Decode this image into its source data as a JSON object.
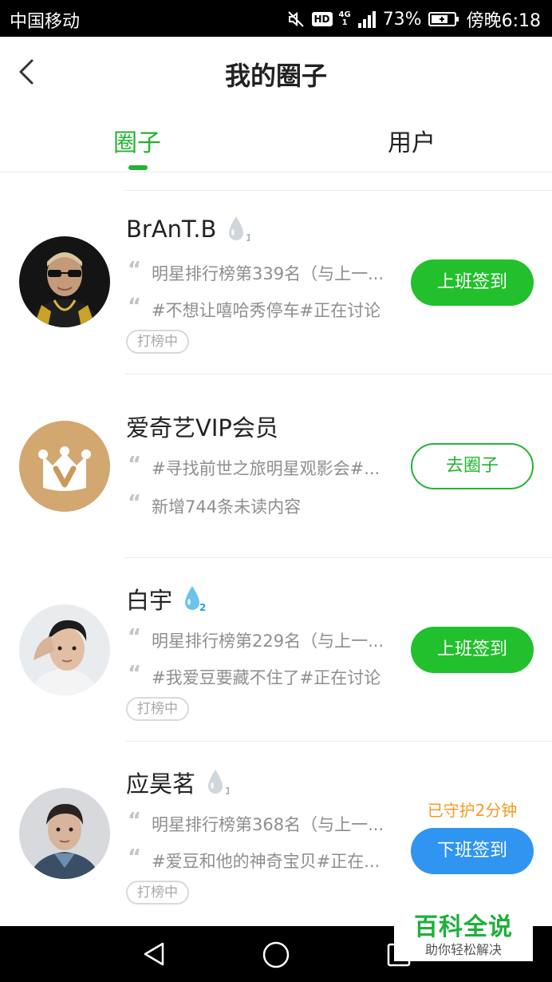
{
  "status_bar": {
    "carrier": "中国移动",
    "hd": "HD",
    "network_top": "4G",
    "network_bottom": "1",
    "battery_percent": "73%",
    "time": "傍晚6:18"
  },
  "header": {
    "title": "我的圈子"
  },
  "tabs": [
    {
      "label": "圈子",
      "active": true
    },
    {
      "label": "用户",
      "active": false
    }
  ],
  "colors": {
    "accent_green": "#22c02c",
    "blue": "#2f95f0",
    "orange": "#f59a23"
  },
  "items": [
    {
      "name": "BrAnT.B",
      "badge_icon": "water-drop-icon",
      "badge_level": "1",
      "lines": [
        "明星排行榜第339名（与上一...",
        "#不想让嘻哈秀停车#正在讨论"
      ],
      "tag": "打榜中",
      "button": "上班签到"
    },
    {
      "name": "爱奇艺VIP会员",
      "lines": [
        "#寻找前世之旅明星观影会#...",
        "新增744条未读内容"
      ],
      "button": "去圈子"
    },
    {
      "name": "白宇",
      "badge_icon": "water-drop-icon",
      "badge_level": "2",
      "lines": [
        "明星排行榜第229名（与上一...",
        "#我爱豆要藏不住了#正在讨论"
      ],
      "tag": "打榜中",
      "button": "上班签到"
    },
    {
      "name": "应昊茗",
      "badge_icon": "water-drop-icon",
      "badge_level": "1",
      "guard_text": "已守护2分钟",
      "lines": [
        "明星排行榜第368名（与上一...",
        "#爱豆和他的神奇宝贝#正在..."
      ],
      "tag": "打榜中",
      "button": "下班签到"
    }
  ],
  "watermark": {
    "title": "百科全说",
    "subtitle": "助你轻松解决"
  }
}
